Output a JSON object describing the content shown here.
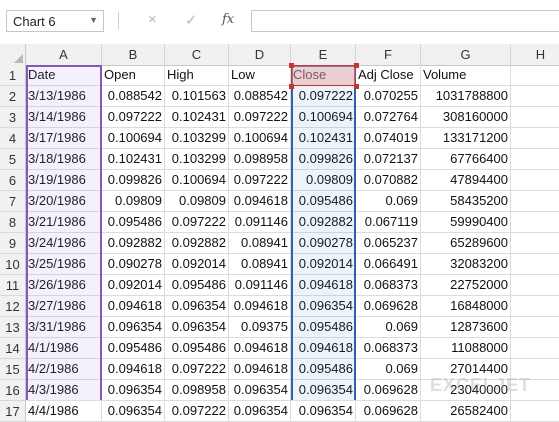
{
  "formula_bar": {
    "name_box": "Chart 6",
    "cancel_icon": "×",
    "enter_icon": "✓",
    "fx_label": "fx",
    "formula_value": ""
  },
  "columns": [
    "A",
    "B",
    "C",
    "D",
    "E",
    "F",
    "G",
    "H"
  ],
  "rows": [
    {
      "n": "1",
      "cells": [
        "Date",
        "Open",
        "High",
        "Low",
        "Close",
        "Adj Close",
        "Volume",
        ""
      ]
    },
    {
      "n": "2",
      "cells": [
        "3/13/1986",
        "0.088542",
        "0.101563",
        "0.088542",
        "0.097222",
        "0.070255",
        "1031788800",
        ""
      ]
    },
    {
      "n": "3",
      "cells": [
        "3/14/1986",
        "0.097222",
        "0.102431",
        "0.097222",
        "0.100694",
        "0.072764",
        "308160000",
        ""
      ]
    },
    {
      "n": "4",
      "cells": [
        "3/17/1986",
        "0.100694",
        "0.103299",
        "0.100694",
        "0.102431",
        "0.074019",
        "133171200",
        ""
      ]
    },
    {
      "n": "5",
      "cells": [
        "3/18/1986",
        "0.102431",
        "0.103299",
        "0.098958",
        "0.099826",
        "0.072137",
        "67766400",
        ""
      ]
    },
    {
      "n": "6",
      "cells": [
        "3/19/1986",
        "0.099826",
        "0.100694",
        "0.097222",
        "0.09809",
        "0.070882",
        "47894400",
        ""
      ]
    },
    {
      "n": "7",
      "cells": [
        "3/20/1986",
        "0.09809",
        "0.09809",
        "0.094618",
        "0.095486",
        "0.069",
        "58435200",
        ""
      ]
    },
    {
      "n": "8",
      "cells": [
        "3/21/1986",
        "0.095486",
        "0.097222",
        "0.091146",
        "0.092882",
        "0.067119",
        "59990400",
        ""
      ]
    },
    {
      "n": "9",
      "cells": [
        "3/24/1986",
        "0.092882",
        "0.092882",
        "0.08941",
        "0.090278",
        "0.065237",
        "65289600",
        ""
      ]
    },
    {
      "n": "10",
      "cells": [
        "3/25/1986",
        "0.090278",
        "0.092014",
        "0.08941",
        "0.092014",
        "0.066491",
        "32083200",
        ""
      ]
    },
    {
      "n": "11",
      "cells": [
        "3/26/1986",
        "0.092014",
        "0.095486",
        "0.091146",
        "0.094618",
        "0.068373",
        "22752000",
        ""
      ]
    },
    {
      "n": "12",
      "cells": [
        "3/27/1986",
        "0.094618",
        "0.096354",
        "0.094618",
        "0.096354",
        "0.069628",
        "16848000",
        ""
      ]
    },
    {
      "n": "13",
      "cells": [
        "3/31/1986",
        "0.096354",
        "0.096354",
        "0.09375",
        "0.095486",
        "0.069",
        "12873600",
        ""
      ]
    },
    {
      "n": "14",
      "cells": [
        "4/1/1986",
        "0.095486",
        "0.095486",
        "0.094618",
        "0.094618",
        "0.068373",
        "11088000",
        ""
      ]
    },
    {
      "n": "15",
      "cells": [
        "4/2/1986",
        "0.094618",
        "0.097222",
        "0.094618",
        "0.095486",
        "0.069",
        "27014400",
        ""
      ]
    },
    {
      "n": "16",
      "cells": [
        "4/3/1986",
        "0.096354",
        "0.098958",
        "0.096354",
        "0.096354",
        "0.069628",
        "23040000",
        ""
      ]
    },
    {
      "n": "17",
      "cells": [
        "4/4/1986",
        "0.096354",
        "0.097222",
        "0.096354",
        "0.096354",
        "0.069628",
        "26582400",
        ""
      ]
    }
  ],
  "colors": {
    "date_range_border": "#7c5cb8",
    "close_range_border": "#2f5fad",
    "close_header_border": "#c0392b"
  }
}
